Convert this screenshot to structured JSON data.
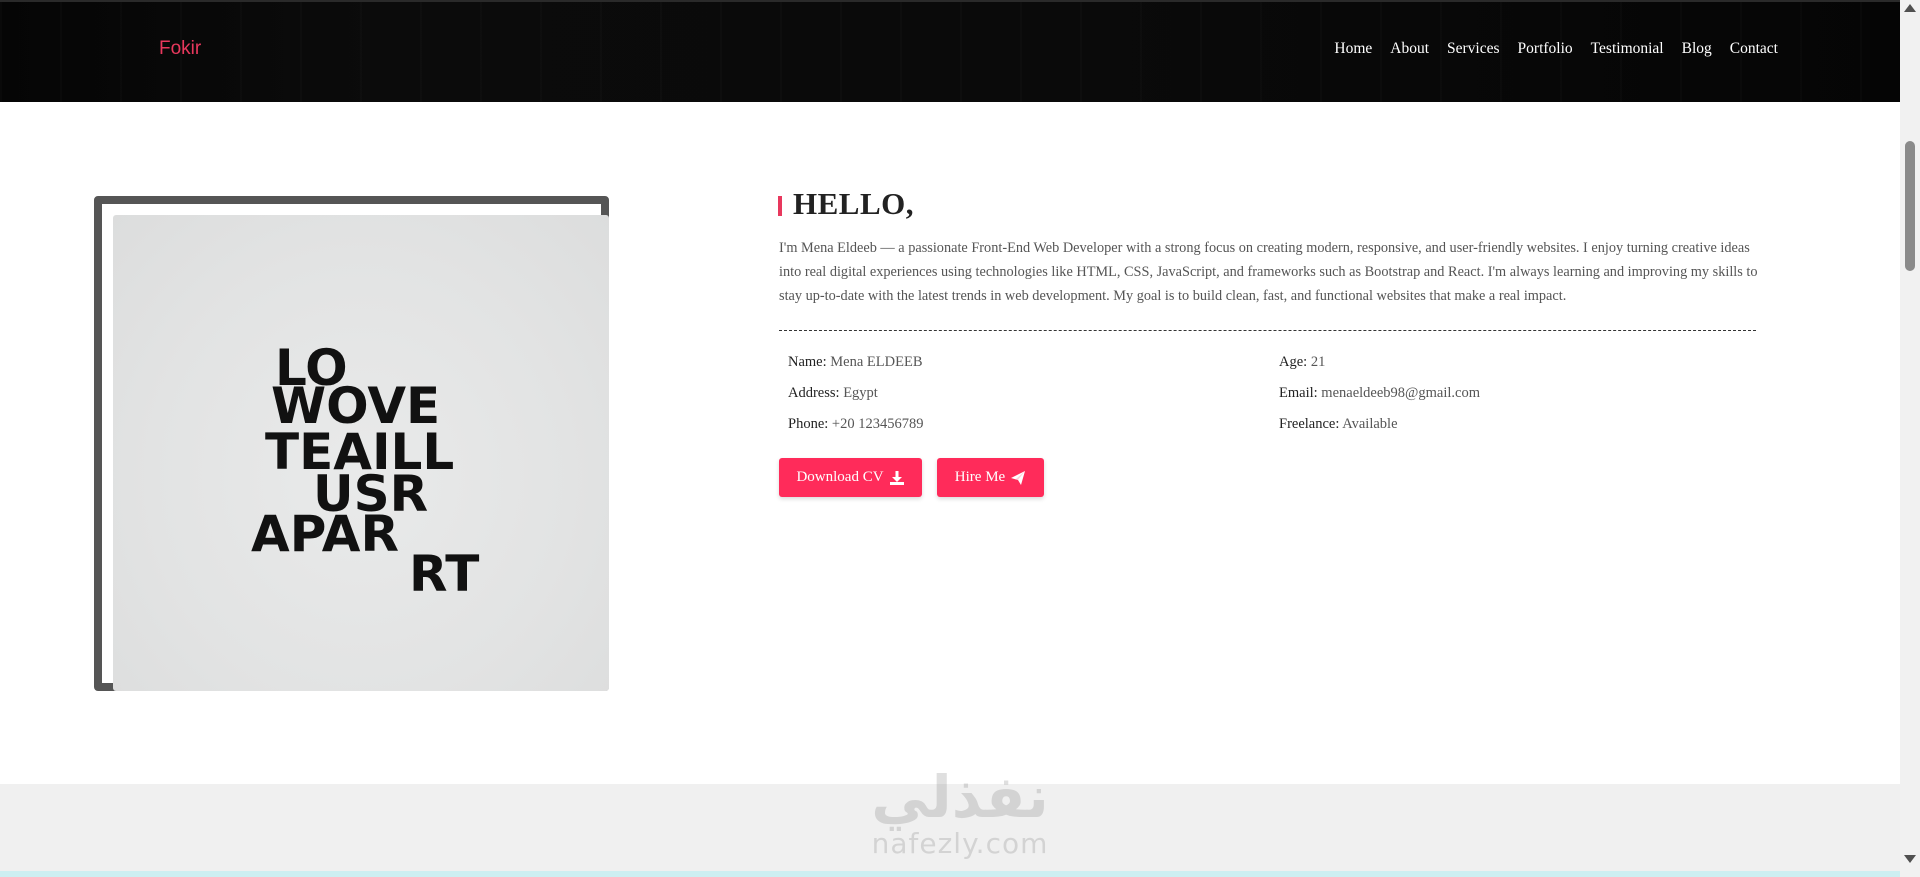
{
  "header": {
    "brand": "Fokir",
    "nav": [
      "Home",
      "About",
      "Services",
      "Portfolio",
      "Testimonial",
      "Blog",
      "Contact"
    ]
  },
  "about": {
    "heading": "HELLO,",
    "intro": "I'm Mena Eldeeb — a passionate Front-End Web Developer with a strong focus on creating modern, responsive, and user-friendly websites. I enjoy turning creative ideas into real digital experiences using technologies like HTML, CSS, JavaScript, and frameworks such as Bootstrap and React. I'm always learning and improving my skills to stay up-to-date with the latest trends in web development. My goal is to build clean, fast, and functional websites that make a real impact.",
    "info": {
      "name_label": "Name:",
      "name_value": "Mena ELDEEB",
      "age_label": "Age:",
      "age_value": "21",
      "address_label": "Address:",
      "address_value": "Egypt",
      "email_label": "Email:",
      "email_value": "menaeldeeb98@gmail.com",
      "phone_label": "Phone:",
      "phone_value": "+20 123456789",
      "freelance_label": "Freelance:",
      "freelance_value": "Available"
    },
    "buttons": {
      "download_cv": "Download CV",
      "hire_me": "Hire Me"
    },
    "poster_lines": [
      "LO",
      "WOVE",
      "TEAILL",
      "USR",
      "APAR",
      "RT"
    ]
  },
  "watermark": {
    "arabic": "نفذلي",
    "latin": "nafezly.com"
  },
  "colors": {
    "accent": "#ff2b5a",
    "brand": "#e8385d",
    "header_bg": "#050505",
    "frame": "#555555"
  },
  "icons": {
    "download": "download-icon",
    "send": "paper-plane-icon"
  }
}
